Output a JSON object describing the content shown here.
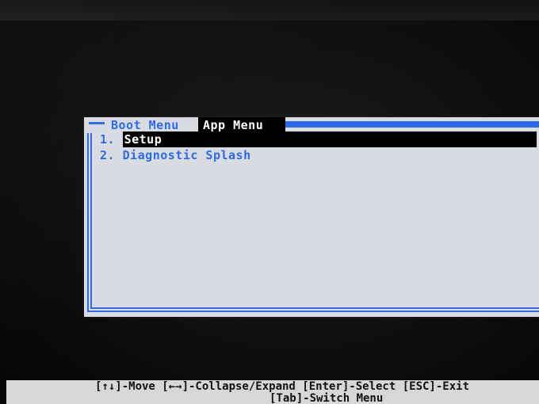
{
  "tabs": [
    {
      "label": "Boot Menu",
      "active": false
    },
    {
      "label": "App Menu",
      "active": true
    }
  ],
  "menu": {
    "items": [
      {
        "number": "1.",
        "label": "Setup",
        "selected": true
      },
      {
        "number": "2.",
        "label": "Diagnostic Splash",
        "selected": false
      }
    ]
  },
  "footer": {
    "line1": "[↑↓]-Move [←→]-Collapse/Expand [Enter]-Select [ESC]-Exit",
    "line2": "[Tab]-Switch Menu"
  },
  "colors": {
    "accent_blue": "#2d6be2",
    "panel_bg": "#d9dbe2",
    "selection_bg": "#000000",
    "selection_fg": "#ffffff",
    "screen_bg": "#0b0b0b"
  }
}
